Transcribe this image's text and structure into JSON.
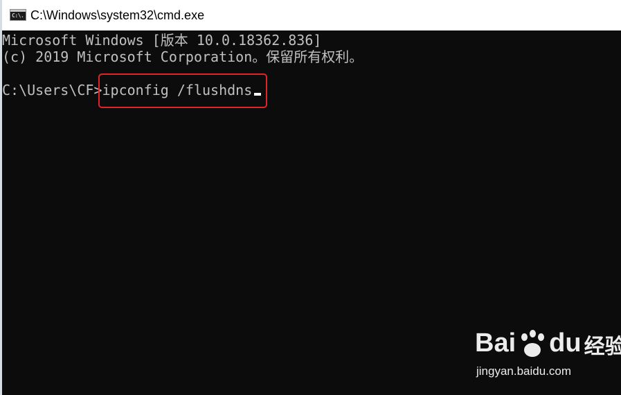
{
  "window": {
    "title": "C:\\Windows\\system32\\cmd.exe",
    "icon": "cmd-console-icon",
    "icon_glyph": "C:\\."
  },
  "console": {
    "lines": [
      "Microsoft Windows [版本 10.0.18362.836]",
      "(c) 2019 Microsoft Corporation。保留所有权利。",
      "",
      "C:\\Users\\CF>ipconfig /flushdns"
    ]
  },
  "annotation": {
    "highlight_color": "#e0242a"
  },
  "watermark": {
    "logo_text_left": "Bai",
    "logo_text_right": "du",
    "logo_text_cn": "经验",
    "url": "jingyan.baidu.com"
  },
  "colors": {
    "console_bg": "#0c0c0c",
    "console_fg": "#c0c0c0",
    "titlebar_bg": "#ffffff"
  }
}
